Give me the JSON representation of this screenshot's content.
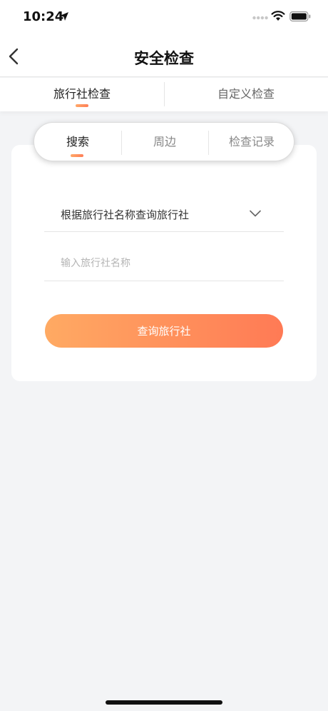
{
  "status_bar": {
    "time": "10:24"
  },
  "nav": {
    "title": "安全检查"
  },
  "main_tabs": [
    {
      "label": "旅行社检查",
      "active": true
    },
    {
      "label": "自定义检查",
      "active": false
    }
  ],
  "segments": [
    {
      "label": "搜索",
      "active": true
    },
    {
      "label": "周边",
      "active": false
    },
    {
      "label": "检查记录",
      "active": false
    }
  ],
  "form": {
    "select_label": "根据旅行社名称查询旅行社",
    "name_input_placeholder": "输入旅行社名称",
    "name_input_value": "",
    "submit_label": "查询旅行社"
  },
  "colors": {
    "accent_start": "#ffa868",
    "accent_end": "#ff7e57",
    "page_bg": "#f3f4f6"
  },
  "icons": [
    "location-arrow-icon",
    "cellular-signal-icon",
    "wifi-icon",
    "battery-icon",
    "back-chevron-icon",
    "chevron-down-icon"
  ]
}
